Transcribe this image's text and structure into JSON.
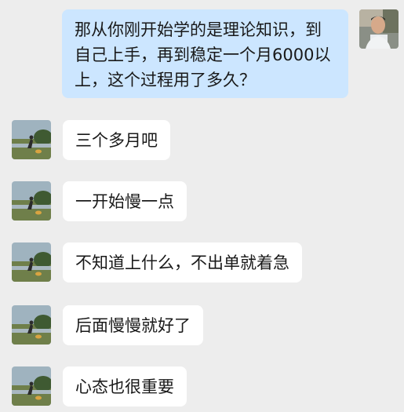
{
  "conversation": {
    "outgoing": {
      "avatar_icon": "user-photo-avatar",
      "lines": [
        "那从你刚开始学的是理论知识，到",
        "自己上手，再到稳定一个月6000以",
        "上，这个过程用了多久？"
      ]
    },
    "incoming": [
      {
        "avatar_icon": "landscape-photo-avatar",
        "text": "三个多月吧"
      },
      {
        "avatar_icon": "landscape-photo-avatar",
        "text": "一开始慢一点"
      },
      {
        "avatar_icon": "landscape-photo-avatar",
        "text": "不知道上什么，不出单就着急"
      },
      {
        "avatar_icon": "landscape-photo-avatar",
        "text": "后面慢慢就好了"
      },
      {
        "avatar_icon": "landscape-photo-avatar",
        "text": "心态也很重要"
      }
    ]
  },
  "colors": {
    "background": "#ededed",
    "outgoing_bubble": "#cce6ff",
    "incoming_bubble": "#ffffff",
    "text": "#191919"
  }
}
